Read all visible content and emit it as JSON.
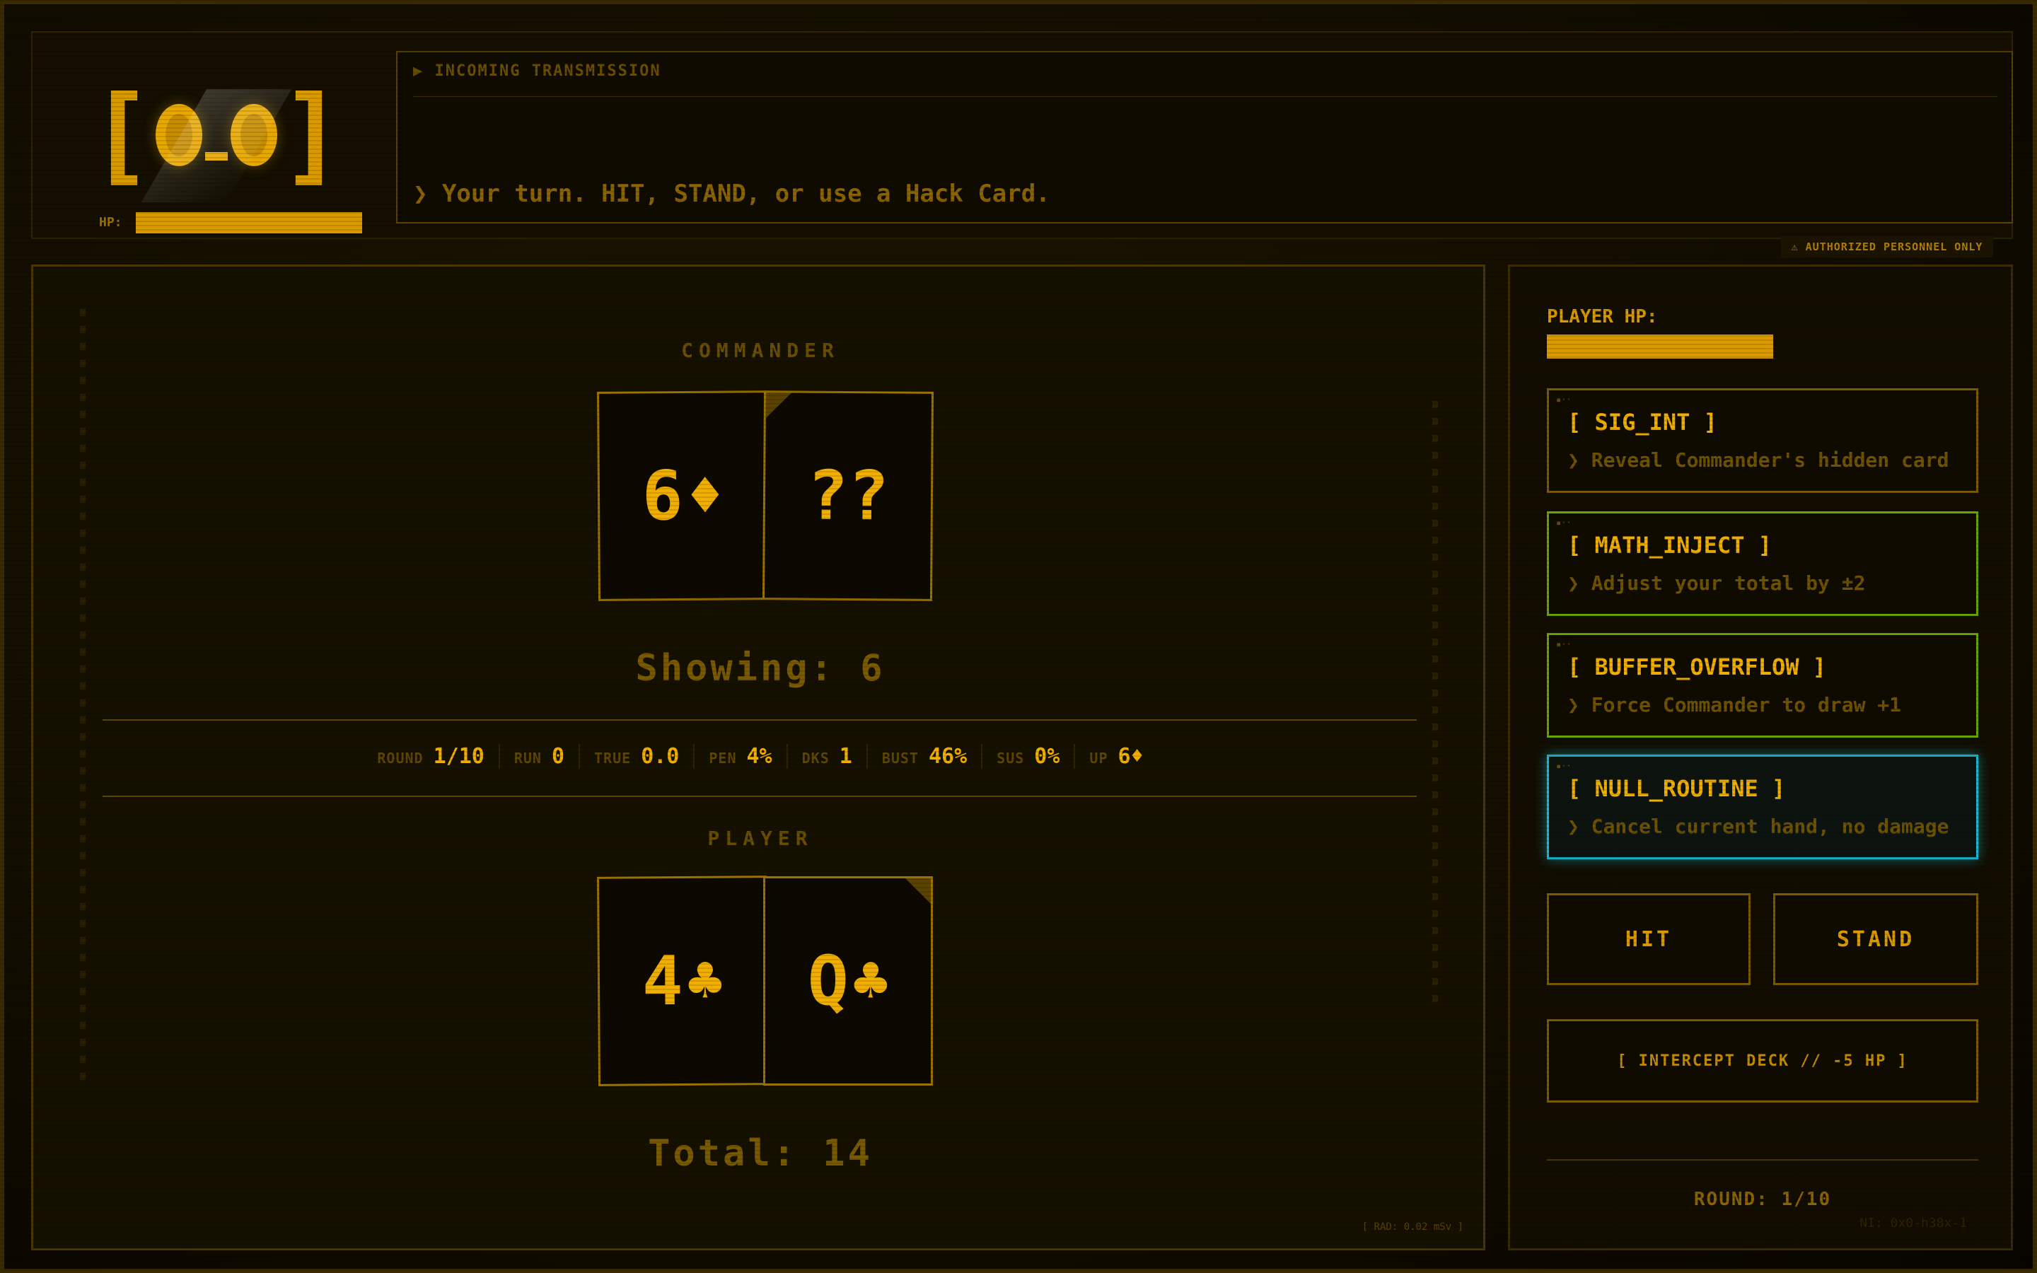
{
  "header": {
    "face_brackets": {
      "left": "[",
      "right": "]"
    },
    "hp_label": "HP:",
    "hp_fraction": 1.0,
    "console_title": "▶ INCOMING TRANSMISSION",
    "console_message": "❯ Your turn. HIT, STAND, or use a Hack Card.",
    "auth_badge": "⚠ AUTHORIZED PERSONNEL ONLY"
  },
  "board": {
    "commander": {
      "label": "COMMANDER",
      "cards": [
        {
          "rank": "6",
          "suit": "♦",
          "hidden": false
        },
        {
          "rank": "??",
          "suit": "",
          "hidden": true
        }
      ],
      "summary": "Showing: 6"
    },
    "player": {
      "label": "PLAYER",
      "cards": [
        {
          "rank": "4",
          "suit": "♣",
          "hidden": false
        },
        {
          "rank": "Q",
          "suit": "♣",
          "hidden": false
        }
      ],
      "summary": "Total: 14"
    },
    "stats": [
      {
        "key": "ROUND",
        "value": "1/10"
      },
      {
        "key": "RUN",
        "value": "0"
      },
      {
        "key": "TRUE",
        "value": "0.0"
      },
      {
        "key": "PEN",
        "value": "4%"
      },
      {
        "key": "DKS",
        "value": "1"
      },
      {
        "key": "BUST",
        "value": "46%"
      },
      {
        "key": "SUS",
        "value": "0%"
      },
      {
        "key": "UP",
        "value": "6♦"
      }
    ],
    "rad_readout": "[ RAD: 0.02 mSv ]"
  },
  "panel": {
    "player_hp_label": "PLAYER HP:",
    "player_hp_fraction": 1.0,
    "hack_cards": [
      {
        "name": "[ SIG_INT ]",
        "desc": "❯ Reveal Commander's hidden card",
        "state": "default"
      },
      {
        "name": "[ MATH_INJECT ]",
        "desc": "❯ Adjust your total by ±2",
        "state": "available"
      },
      {
        "name": "[ BUFFER_OVERFLOW ]",
        "desc": "❯ Force Commander to draw +1",
        "state": "available"
      },
      {
        "name": "[ NULL_ROUTINE ]",
        "desc": "❯ Cancel current hand, no damage",
        "state": "selected"
      }
    ],
    "hit_label": "HIT",
    "stand_label": "STAND",
    "intercept_label": "[ INTERCEPT DECK // -5 HP ]",
    "round_label": "ROUND: 1/10",
    "build_tag": "NI: 0x0-h38x-1"
  },
  "colors": {
    "accent": "#e8a800",
    "available_border": "#68a400",
    "selected_border": "#18b8d0",
    "background": "#120d00"
  }
}
